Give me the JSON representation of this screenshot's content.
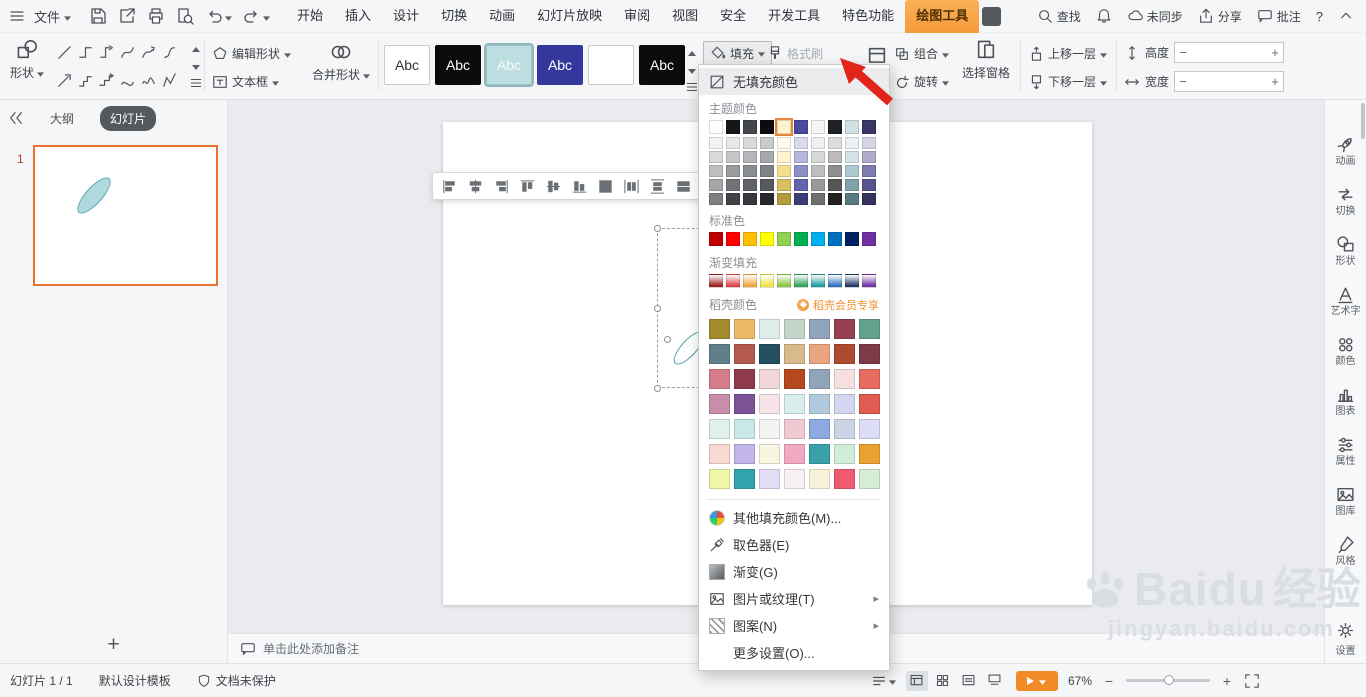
{
  "menu_bar": {
    "file_label": "文件",
    "tabs": [
      {
        "label": "开始",
        "active": false
      },
      {
        "label": "插入",
        "active": false
      },
      {
        "label": "设计",
        "active": false
      },
      {
        "label": "切换",
        "active": false
      },
      {
        "label": "动画",
        "active": false
      },
      {
        "label": "幻灯片放映",
        "active": false
      },
      {
        "label": "审阅",
        "active": false
      },
      {
        "label": "视图",
        "active": false
      },
      {
        "label": "安全",
        "active": false
      },
      {
        "label": "开发工具",
        "active": false
      },
      {
        "label": "特色功能",
        "active": false
      },
      {
        "label": "绘图工具",
        "active": true
      }
    ],
    "search_label": "查找",
    "sync_label": "未同步",
    "share_label": "分享",
    "comment_label": "批注",
    "help_label": "?"
  },
  "ribbon": {
    "shapes_label": "形状",
    "edit_shape_label": "编辑形状",
    "textbox_label": "文本框",
    "merge_shapes_label": "合并形状",
    "text_style_presets": [
      {
        "label": "Abc",
        "bg": "#ffffff",
        "fg": "#333333",
        "border": "#c9ccce",
        "selected": false
      },
      {
        "label": "Abc",
        "bg": "#0b0b0b",
        "fg": "#ffffff",
        "border": "#0b0b0b",
        "selected": false
      },
      {
        "label": "Abc",
        "bg": "#bddde1",
        "fg": "#f2fafb",
        "border": "#9fc6cb",
        "selected": true
      },
      {
        "label": "Abc",
        "bg": "#34379b",
        "fg": "#ffffff",
        "border": "#34379b",
        "selected": false
      },
      {
        "label": "",
        "bg": "#ffffff",
        "fg": "#333333",
        "border": "#c9ccce",
        "selected": false
      },
      {
        "label": "Abc",
        "bg": "#0b0b0b",
        "fg": "#ffffff",
        "border": "#0b0b0b",
        "selected": false
      }
    ],
    "fill_label": "填充",
    "format_painter_label": "格式刷",
    "group_label": "组合",
    "rotate_label": "旋转",
    "selection_pane_label": "选择窗格",
    "bring_forward_label": "上移一层",
    "send_backward_label": "下移一层",
    "height_label": "高度",
    "width_label": "宽度",
    "height_value": "",
    "width_value": ""
  },
  "left_panel": {
    "outline_tab": "大纲",
    "slides_tab": "幻灯片",
    "slide_number": "1",
    "add_label": "+"
  },
  "fill_menu": {
    "no_fill_label": "无填充颜色",
    "theme_label": "主题颜色",
    "standard_label": "标准色",
    "gradient_label": "渐变填充",
    "docer_label": "稻壳颜色",
    "docer_vip_label": "稻壳会员专享",
    "theme_selected_index": 4,
    "theme_colors": [
      "#FFFFFF",
      "#14161A",
      "#43464C",
      "#0B0C0E",
      "#FFF3CC",
      "#4A4AA0",
      "#F5F5F5",
      "#1F2125",
      "#D0E1E3",
      "#3A3766"
    ],
    "theme_tints": [
      [
        "#F2F2F2",
        "#E8E9E9",
        "#D8D9DB",
        "#C8CACC",
        "#FFFBF0",
        "#DADAEE",
        "#EFEFEF",
        "#DDDDDD",
        "#EAF1F2",
        "#D6D5E4"
      ],
      [
        "#D9D9D9",
        "#C6C7C9",
        "#B4B6B9",
        "#A6A8AC",
        "#FFF2CC",
        "#B6B6DE",
        "#D8D8D8",
        "#BBBBBB",
        "#D5E3E6",
        "#ADABC9"
      ],
      [
        "#BFBFBF",
        "#9A9C9F",
        "#8A8D91",
        "#7F8287",
        "#F5DE8C",
        "#8F8FC8",
        "#BFBFBF",
        "#8F8F8F",
        "#ABCBD0",
        "#7E7BAE"
      ],
      [
        "#A6A6A6",
        "#717479",
        "#606468",
        "#56595E",
        "#D9BF5E",
        "#6464AE",
        "#9A9A9A",
        "#555555",
        "#7FA3A9",
        "#565390"
      ],
      [
        "#7F7F7F",
        "#3F4246",
        "#36393D",
        "#27292C",
        "#B39C3D",
        "#3C3C78",
        "#6F6F6F",
        "#222222",
        "#597A7F",
        "#35325F"
      ]
    ],
    "standard_colors": [
      "#C00000",
      "#FF0000",
      "#FFC000",
      "#FFFF00",
      "#92D050",
      "#00B050",
      "#00B0F0",
      "#0070C0",
      "#002060",
      "#7030A0"
    ],
    "gradient_colors": [
      "#9E1F1F",
      "#E04343",
      "#F2A33C",
      "#EFE243",
      "#8CC63F",
      "#2FA45C",
      "#1E9D9D",
      "#2F6FBF",
      "#1F3864",
      "#7030A0"
    ],
    "docer_rows": [
      [
        "#A58A2D",
        "#ECB968",
        "#DCEDEA",
        "#C3D5C9",
        "#90A4BD",
        "#94404E",
        "#66A18C"
      ],
      [
        "#5F8089",
        "#B45B4D",
        "#24505F",
        "#D9BA8B",
        "#EAA480",
        "#AE4A30",
        "#7E3B47"
      ],
      [
        "#D57D89",
        "#8E3A4A",
        "#F2D7D9",
        "#B5481F",
        "#91A5B9",
        "#F6DFDF",
        "#E86B5F"
      ],
      [
        "#C98CA9",
        "#7C5296",
        "#F6E4E9",
        "#D9EDED",
        "#B0C9DD",
        "#D5D5F1",
        "#E05B51"
      ],
      [
        "#E0F1E9",
        "#C9E9E9",
        "#F2F5F2",
        "#F1C9D3",
        "#8DA9E1",
        "#C9D5E5",
        "#DDDDF5"
      ],
      [
        "#F9D9D1",
        "#C1B5E9",
        "#F9F5E1",
        "#F1A9C1",
        "#39A1A9",
        "#D1EDD9",
        "#E9A131"
      ],
      [
        "#EEF6A9",
        "#30A4AD",
        "#E4DDF8",
        "#F8F0F0",
        "#F8F1DA",
        "#F05A6F",
        "#D6EED6"
      ]
    ],
    "items": [
      {
        "label": "其他填充颜色(M)...",
        "icon": "palette",
        "submenu": false
      },
      {
        "label": "取色器(E)",
        "icon": "eyedropper",
        "submenu": false
      },
      {
        "label": "渐变(G)",
        "icon": "gradient-swatch",
        "submenu": false
      },
      {
        "label": "图片或纹理(T)",
        "icon": "picture",
        "submenu": true
      },
      {
        "label": "图案(N)",
        "icon": "pattern",
        "submenu": true
      },
      {
        "label": "更多设置(O)...",
        "icon": "none",
        "submenu": false
      }
    ]
  },
  "notes_bar": {
    "placeholder": "单击此处添加备注"
  },
  "status_bar": {
    "slide_indicator": "幻灯片 1 / 1",
    "template_name": "默认设计模板",
    "protection_status": "文档未保护",
    "zoom_level": "67%"
  },
  "right_sidebar": {
    "items": [
      {
        "label": "动画",
        "icon": "rocket"
      },
      {
        "label": "切换",
        "icon": "transition"
      },
      {
        "label": "形状",
        "icon": "shape"
      },
      {
        "label": "艺术字",
        "icon": "wordart"
      },
      {
        "label": "颜色",
        "icon": "colordots"
      },
      {
        "label": "图表",
        "icon": "chart"
      },
      {
        "label": "属性",
        "icon": "props"
      },
      {
        "label": "图库",
        "icon": "gallery"
      },
      {
        "label": "风格",
        "icon": "stylebrush"
      }
    ],
    "settings_label": "设置"
  },
  "watermark": {
    "brand": "Baidu",
    "brand_suffix": "经验",
    "url": "jingyan.baidu.com"
  },
  "colors": {
    "active_tab_orange": "#f59b3c",
    "arrow_red": "#e3241b",
    "thumbnail_border": "#e8722e",
    "play_button": "#f28b27",
    "vip_orange": "#ef8f2f",
    "selected_swatch_outline": "#e8833a"
  }
}
